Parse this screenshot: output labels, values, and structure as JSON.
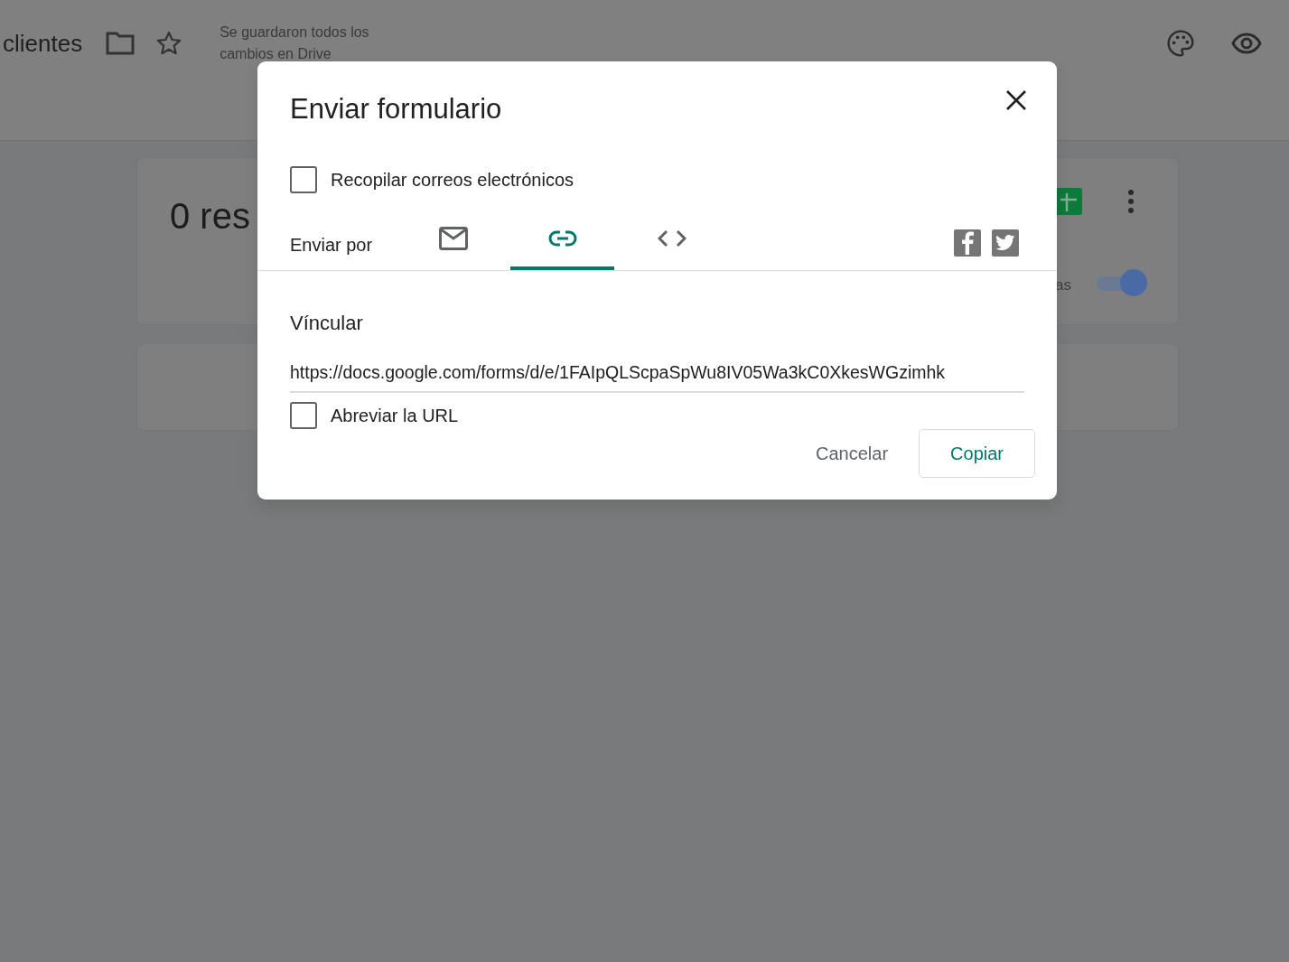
{
  "app": {
    "title": "clientes",
    "save_status": "Se guardaron todos los cambios en Drive"
  },
  "summary_card": {
    "heading": "0 res",
    "toggle_label": "as",
    "accepting": true
  },
  "dialog": {
    "title": "Enviar formulario",
    "collect_emails": {
      "label": "Recopilar correos electrónicos",
      "checked": false
    },
    "send_via_label": "Enviar por",
    "tabs": [
      {
        "kind": "email",
        "selected": false
      },
      {
        "kind": "link",
        "selected": true
      },
      {
        "kind": "embed",
        "selected": false
      }
    ],
    "share": [
      {
        "kind": "facebook"
      },
      {
        "kind": "twitter"
      }
    ],
    "section_title": "Víncular",
    "link_value": "https://docs.google.com/forms/d/e/1FAIpQLScpaSpWu8IV05Wa3kC0XkesWGzimhk",
    "shorten_url": {
      "label": "Abreviar la URL",
      "checked": false
    },
    "buttons": [
      {
        "kind": "cancel",
        "label": "Cancelar"
      },
      {
        "kind": "primary",
        "label": "Copiar"
      }
    ]
  }
}
